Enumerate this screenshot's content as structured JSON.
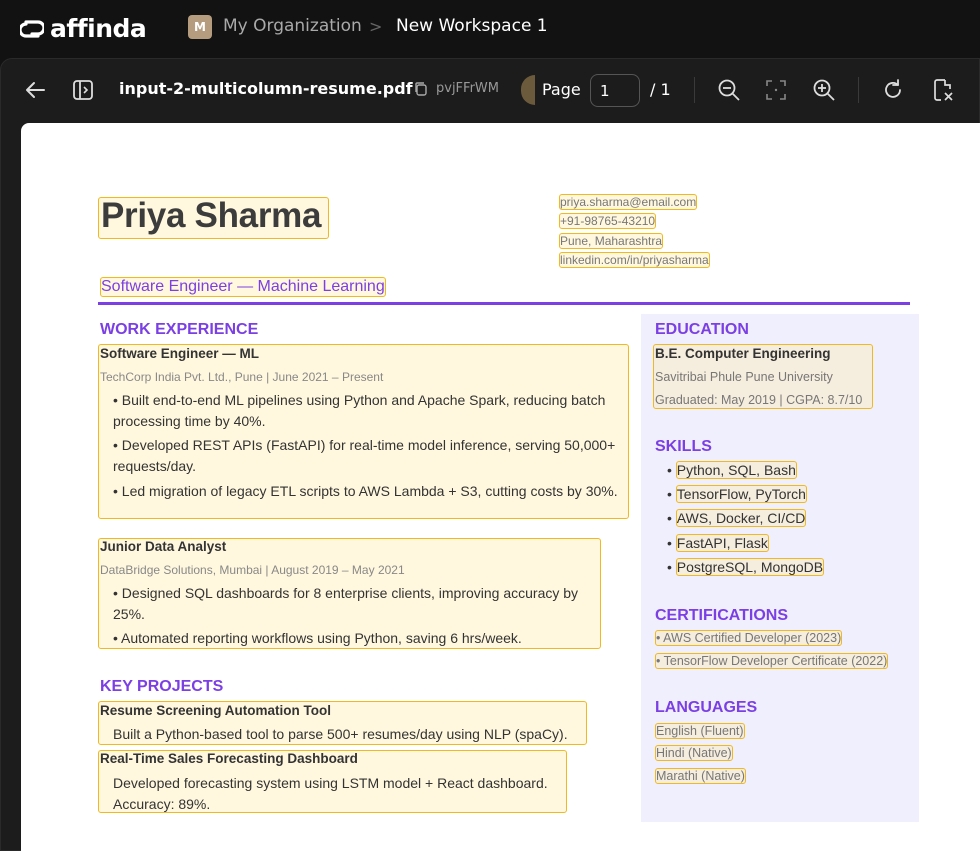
{
  "app": {
    "brand": "affinda"
  },
  "breadcrumb": {
    "org_initial": "M",
    "org": "My Organization",
    "separator": ">",
    "workspace": "New Workspace 1"
  },
  "toolbar": {
    "filename": "input-2-multicolumn-resume.pdf",
    "doc_id": "pvjFFrWM",
    "page_label": "Page",
    "page_value": "1",
    "page_total": "/ 1"
  },
  "resume": {
    "name": "Priya Sharma",
    "contact": [
      "priya.sharma@email.com",
      "+91-98765-43210",
      "Pune, Maharashtra",
      "linkedin.com/in/priyasharma"
    ],
    "subtitle": "Software Engineer — Machine Learning",
    "work_heading": "WORK EXPERIENCE",
    "jobs": [
      {
        "title": "Software Engineer — ML",
        "meta": "TechCorp India Pvt. Ltd., Pune | June 2021 – Present",
        "bullets": [
          "• Built end-to-end ML pipelines using Python and Apache Spark, reducing batch processing time by 40%.",
          "• Developed REST APIs (FastAPI) for real-time model inference, serving 50,000+ requests/day.",
          "• Led migration of legacy ETL scripts to AWS Lambda + S3, cutting costs by 30%."
        ]
      },
      {
        "title": "Junior Data Analyst",
        "meta": "DataBridge Solutions, Mumbai | August 2019 – May 2021",
        "bullets": [
          "• Designed SQL dashboards for 8 enterprise clients, improving accuracy by 25%.",
          "• Automated reporting workflows using Python, saving 6 hrs/week."
        ]
      }
    ],
    "projects_heading": "KEY PROJECTS",
    "projects": [
      {
        "title": "Resume Screening Automation Tool",
        "desc": "Built a Python-based tool to parse 500+ resumes/day using NLP (spaCy)."
      },
      {
        "title": "Real-Time Sales Forecasting Dashboard",
        "desc": "Developed forecasting system using LSTM model + React dashboard.",
        "desc2": "Accuracy: 89%."
      }
    ],
    "education_heading": "EDUCATION",
    "degree": "B.E. Computer Engineering",
    "university": "Savitribai Phule Pune University",
    "graduated": "Graduated: May 2019 | CGPA: 8.7/10",
    "skills_heading": "SKILLS",
    "skills": [
      "Python, SQL, Bash",
      "TensorFlow, PyTorch",
      "AWS, Docker, CI/CD",
      "FastAPI, Flask",
      "PostgreSQL, MongoDB"
    ],
    "certs_heading": "CERTIFICATIONS",
    "certs": [
      "• AWS Certified Developer (2023)",
      "• TensorFlow Developer Certificate (2022)"
    ],
    "languages_heading": "LANGUAGES",
    "languages": [
      "English (Fluent)",
      "Hindi (Native)",
      "Marathi (Native)"
    ]
  },
  "colors": {
    "accent": "#7b3fe4",
    "highlight": "#f2b820",
    "background": "#121212"
  }
}
